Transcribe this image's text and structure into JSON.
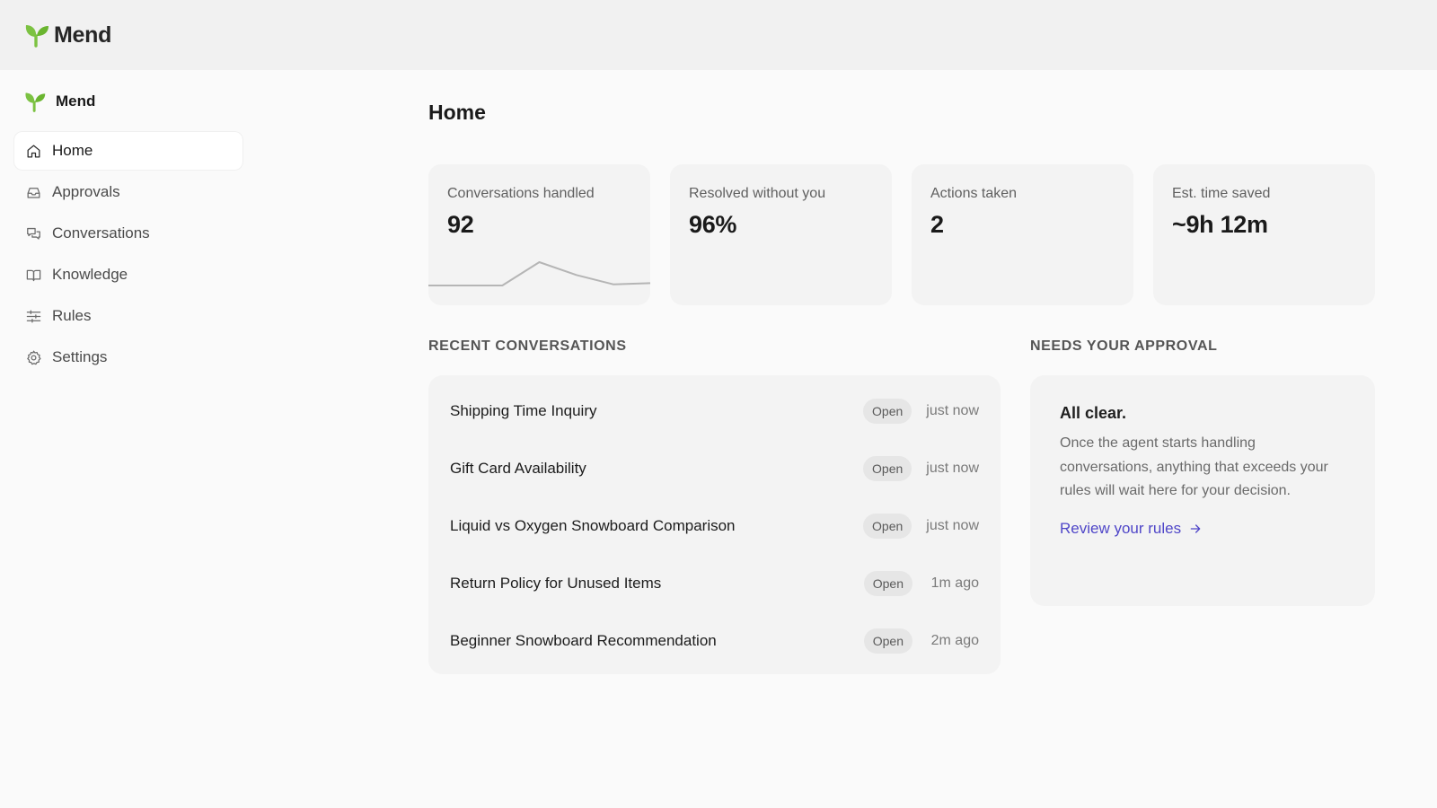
{
  "app": {
    "name": "Mend",
    "accent": "#4f46c8",
    "logo_color": "#7cc242"
  },
  "sidebar": {
    "brand": "Mend",
    "items": [
      {
        "label": "Home",
        "icon": "home-icon",
        "active": true
      },
      {
        "label": "Approvals",
        "icon": "inbox-icon",
        "active": false
      },
      {
        "label": "Conversations",
        "icon": "chat-bubbles-icon",
        "active": false
      },
      {
        "label": "Knowledge",
        "icon": "book-icon",
        "active": false
      },
      {
        "label": "Rules",
        "icon": "sliders-icon",
        "active": false
      },
      {
        "label": "Settings",
        "icon": "gear-icon",
        "active": false
      }
    ]
  },
  "main": {
    "title": "Home",
    "stats": [
      {
        "label": "Conversations handled",
        "value": "92",
        "sparkline": [
          0,
          0,
          0,
          1,
          0.45,
          0.05,
          0.1
        ]
      },
      {
        "label": "Resolved without you",
        "value": "96%"
      },
      {
        "label": "Actions taken",
        "value": "2"
      },
      {
        "label": "Est. time saved",
        "value": "~9h 12m"
      }
    ],
    "recent": {
      "title": "RECENT CONVERSATIONS",
      "rows": [
        {
          "title": "Shipping Time Inquiry",
          "status": "Open",
          "time": "just now"
        },
        {
          "title": "Gift Card Availability",
          "status": "Open",
          "time": "just now"
        },
        {
          "title": "Liquid vs Oxygen Snowboard Comparison",
          "status": "Open",
          "time": "just now"
        },
        {
          "title": "Return Policy for Unused Items",
          "status": "Open",
          "time": "1m ago"
        },
        {
          "title": "Beginner Snowboard Recommendation",
          "status": "Open",
          "time": "2m ago"
        }
      ]
    },
    "approval": {
      "title": "NEEDS YOUR APPROVAL",
      "heading": "All clear.",
      "body": "Once the agent starts handling conversations, anything that exceeds your rules will wait here for your decision.",
      "link": "Review your rules"
    }
  }
}
